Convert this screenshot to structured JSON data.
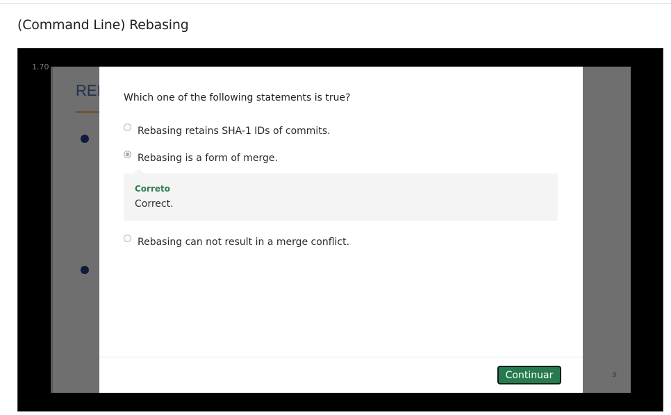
{
  "page": {
    "title": "(Command Line) Rebasing"
  },
  "player": {
    "playback_rate": "1.70",
    "slide": {
      "heading_fragment": "REI",
      "page_number": "9"
    }
  },
  "quiz": {
    "question": "Which one of the following statements is true?",
    "options": [
      {
        "label": "Rebasing retains SHA-1 IDs of commits.",
        "selected": false
      },
      {
        "label": "Rebasing is a form of merge.",
        "selected": true
      },
      {
        "label": "Rebasing can not result in a merge conflict.",
        "selected": false
      }
    ],
    "feedback": {
      "status": "Correto",
      "message": "Correct."
    },
    "continue_label": "Continuar"
  },
  "colors": {
    "accent_green": "#267a4e",
    "feedback_green": "#2e7d4f",
    "slide_heading": "#1e3252"
  }
}
